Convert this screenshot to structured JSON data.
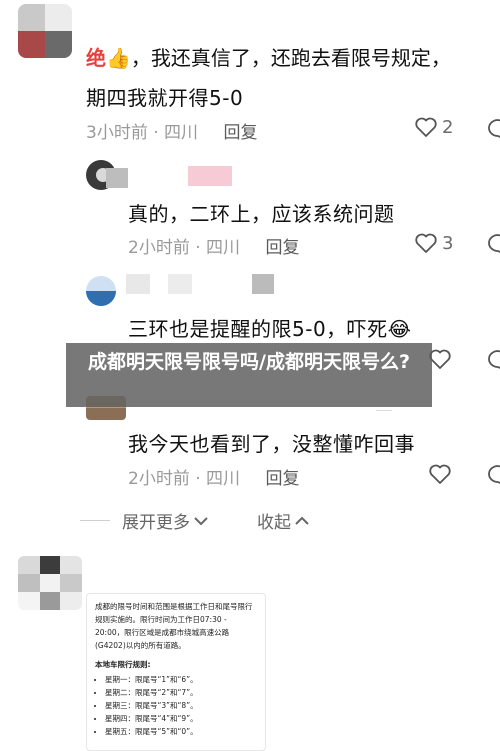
{
  "comments": [
    {
      "prefix": "绝",
      "emoji": "👍",
      "text_line1": "，我还真信了，还跑去看限号规定，",
      "text_line2": "期四我就开得5-0",
      "time": "3小时前",
      "location": "四川",
      "reply_label": "回复",
      "likes": "2"
    },
    {
      "text": "真的，二环上，应该系统问题",
      "time": "2小时前",
      "location": "四川",
      "reply_label": "回复",
      "likes": "3"
    },
    {
      "text": "三环也是提醒的限5-0，吓死",
      "emoji": "😂",
      "time": "",
      "location": "",
      "reply_label": "",
      "likes": ""
    },
    {
      "text": "我今天也看到了，没整懂咋回事",
      "time": "2小时前",
      "location": "四川",
      "reply_label": "回复",
      "likes": ""
    }
  ],
  "separator": "·",
  "expand": {
    "more_label": "展开更多",
    "collapse_label": "收起"
  },
  "overlay": {
    "title": "成都明天限号限号吗/成都明天限号么?"
  },
  "notice": {
    "paragraph": "成都的限号时间和范围是根据工作日和尾号限行规则实施的。限行时间为工作日07:30 - 20:00，限行区域是成都市绕城高速公路(G4202)以内的所有道路。",
    "rules_title": "本地车限行规则:",
    "rules": [
      "星期一：限尾号“1”和“6”。",
      "星期二：限尾号“2”和“7”。",
      "星期三：限尾号“3”和“8”。",
      "星期四：限尾号“4”和“9”。",
      "星期五：限尾号“5”和“0”。"
    ]
  },
  "colors": {
    "accent_red": "#e8403d",
    "meta_gray": "#9a9a9a",
    "overlay_bg": "#5a5a5a"
  },
  "icons": [
    "heart-icon",
    "comment-bubble-icon",
    "chevron-down-icon",
    "chevron-up-icon"
  ]
}
